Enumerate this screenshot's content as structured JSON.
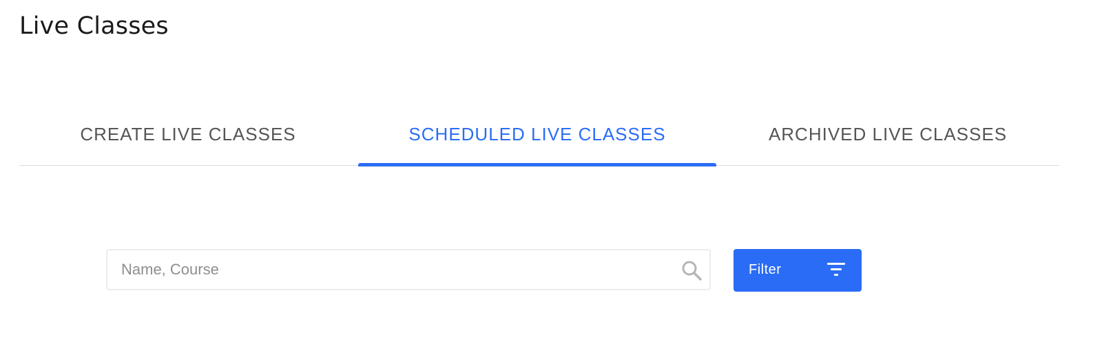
{
  "header": {
    "title": "Live Classes"
  },
  "tabs": [
    {
      "label": "CREATE LIVE CLASSES",
      "active": false
    },
    {
      "label": "SCHEDULED LIVE CLASSES",
      "active": true
    },
    {
      "label": "ARCHIVED LIVE CLASSES",
      "active": false
    }
  ],
  "search": {
    "placeholder": "Name, Course",
    "value": "",
    "icon": "search-icon"
  },
  "filter": {
    "label": "Filter",
    "icon": "filter-icon"
  },
  "colors": {
    "accent": "#2a6cf6",
    "tab_inactive": "#555555",
    "divider": "#dcdcdc"
  }
}
